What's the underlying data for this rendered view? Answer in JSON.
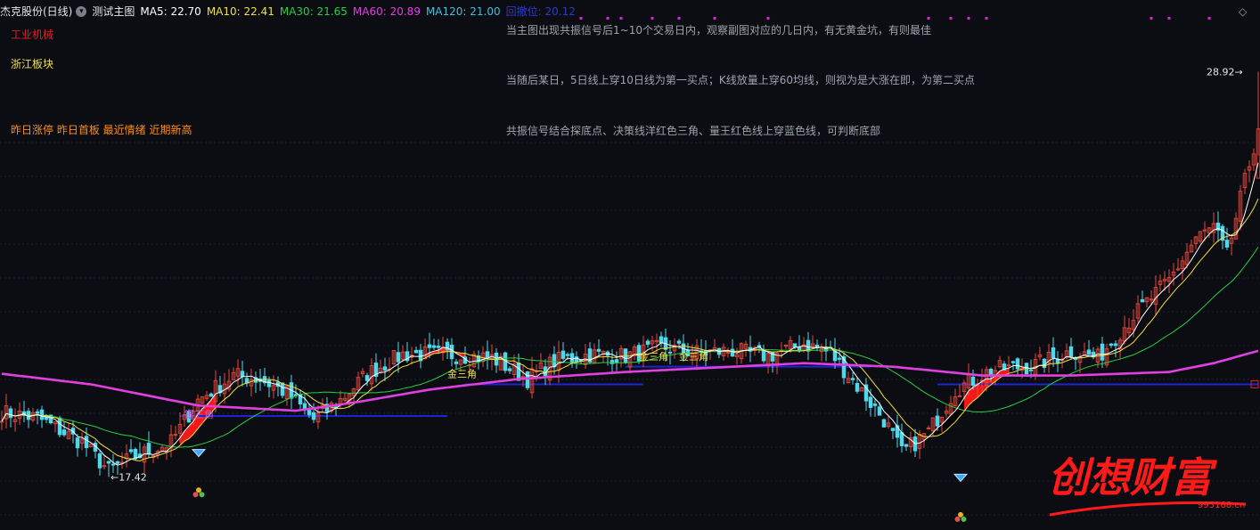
{
  "header": {
    "stock_name": "杰克股份(日线)",
    "indicator_name": "测试主图",
    "ma5": "MA5: 22.70",
    "ma10": "MA10: 22.41",
    "ma30": "MA30: 21.65",
    "ma60": "MA60: 20.89",
    "ma120": "MA120: 21.00",
    "faded": "回撤位: 20.12"
  },
  "labels": {
    "industry": "工业机械",
    "region": "浙江板块",
    "flags": "昨日涨停 昨日首板 最近情绪 近期新高"
  },
  "notes": [
    "当主图出现共振信号后1~10个交易日内，观察副图对应的几日内，有无黄金坑，有则最佳",
    "当随后某日，5日线上穿10日线为第一买点；K线放量上穿60均线，则视为是大涨在即，为第二买点",
    "共振信号结合探底点、决策线洋红色三角、量王红色线上穿蓝色线，可判断底部"
  ],
  "annotations": {
    "high_label": "28.92",
    "low_label": "17.42",
    "silver_triangle": "银三角",
    "gold_triangle_1": "金三角",
    "gold_triangle_2": "金三角",
    "gold_triangle_3": "金三角"
  },
  "watermark": {
    "text": "创想财富",
    "url": "995168.cn"
  },
  "colors": {
    "background": "#0b0d12",
    "up": "#e8463b",
    "down": "#4fd8ea",
    "ma5": "#ffffff",
    "ma10": "#f0e040",
    "ma30": "#28d040",
    "ma60": "#e040e0",
    "ma120": "#40c0e0",
    "support_line": "#1c24d8",
    "signal_mark": "#e020e0"
  },
  "chart_data": {
    "type": "candlestick",
    "period": "daily",
    "ylim": [
      16.8,
      30.2
    ],
    "price_high": 28.92,
    "price_low": 17.42,
    "ma_last": {
      "MA5": 22.7,
      "MA10": 22.41,
      "MA30": 21.65,
      "MA60": 20.89,
      "MA120": 21.0
    },
    "keypoints": [
      [
        0,
        19.25
      ],
      [
        8,
        19.1
      ],
      [
        18,
        18.4
      ],
      [
        24,
        17.6
      ],
      [
        30,
        18.0
      ],
      [
        38,
        18.4
      ],
      [
        44,
        19.6
      ],
      [
        52,
        20.3
      ],
      [
        58,
        20.2
      ],
      [
        64,
        19.8
      ],
      [
        70,
        19.05
      ],
      [
        76,
        19.6
      ],
      [
        82,
        20.35
      ],
      [
        90,
        20.9
      ],
      [
        100,
        20.9
      ],
      [
        110,
        20.8
      ],
      [
        118,
        20.2
      ],
      [
        124,
        20.7
      ],
      [
        132,
        20.9
      ],
      [
        140,
        20.85
      ],
      [
        148,
        21.1
      ],
      [
        156,
        20.95
      ],
      [
        164,
        21.0
      ],
      [
        172,
        20.85
      ],
      [
        180,
        21.2
      ],
      [
        186,
        20.95
      ],
      [
        192,
        20.0
      ],
      [
        198,
        19.05
      ],
      [
        202,
        18.1
      ],
      [
        208,
        18.7
      ],
      [
        214,
        19.9
      ],
      [
        222,
        20.45
      ],
      [
        232,
        20.6
      ],
      [
        240,
        21.0
      ],
      [
        246,
        20.8
      ],
      [
        254,
        22.0
      ],
      [
        262,
        23.0
      ],
      [
        268,
        24.2
      ],
      [
        272,
        24.5
      ],
      [
        275,
        23.7
      ],
      [
        278,
        25.3
      ],
      [
        282,
        27.3
      ]
    ],
    "ma60_keypoints": [
      [
        0,
        20.35
      ],
      [
        20,
        20.05
      ],
      [
        44,
        19.45
      ],
      [
        66,
        19.3
      ],
      [
        80,
        19.55
      ],
      [
        96,
        19.9
      ],
      [
        116,
        20.2
      ],
      [
        140,
        20.4
      ],
      [
        180,
        20.65
      ],
      [
        200,
        20.55
      ],
      [
        220,
        20.3
      ],
      [
        240,
        20.3
      ],
      [
        262,
        20.4
      ],
      [
        272,
        20.65
      ],
      [
        282,
        21.0
      ]
    ],
    "support_levels": [
      {
        "from": 40,
        "to": 100,
        "price": 19.15
      },
      {
        "from": 104,
        "to": 144,
        "price": 20.05
      },
      {
        "from": 140,
        "to": 195,
        "price": 20.55
      },
      {
        "from": 210,
        "to": 282,
        "price": 20.05
      }
    ],
    "signal_days": [
      130,
      136,
      139,
      146,
      152,
      160,
      172,
      208,
      213,
      217,
      221,
      258,
      262,
      271
    ],
    "diamond_days": [
      44,
      215
    ],
    "cluster_days": [
      44,
      215
    ],
    "triangle_fills": [
      {
        "from": 40,
        "to": 48,
        "color": "red"
      },
      {
        "from": 88,
        "to": 95,
        "color": "black"
      },
      {
        "from": 95,
        "to": 104,
        "color": "red"
      },
      {
        "from": 204,
        "to": 216,
        "color": "black"
      },
      {
        "from": 216,
        "to": 226,
        "color": "red"
      }
    ]
  }
}
